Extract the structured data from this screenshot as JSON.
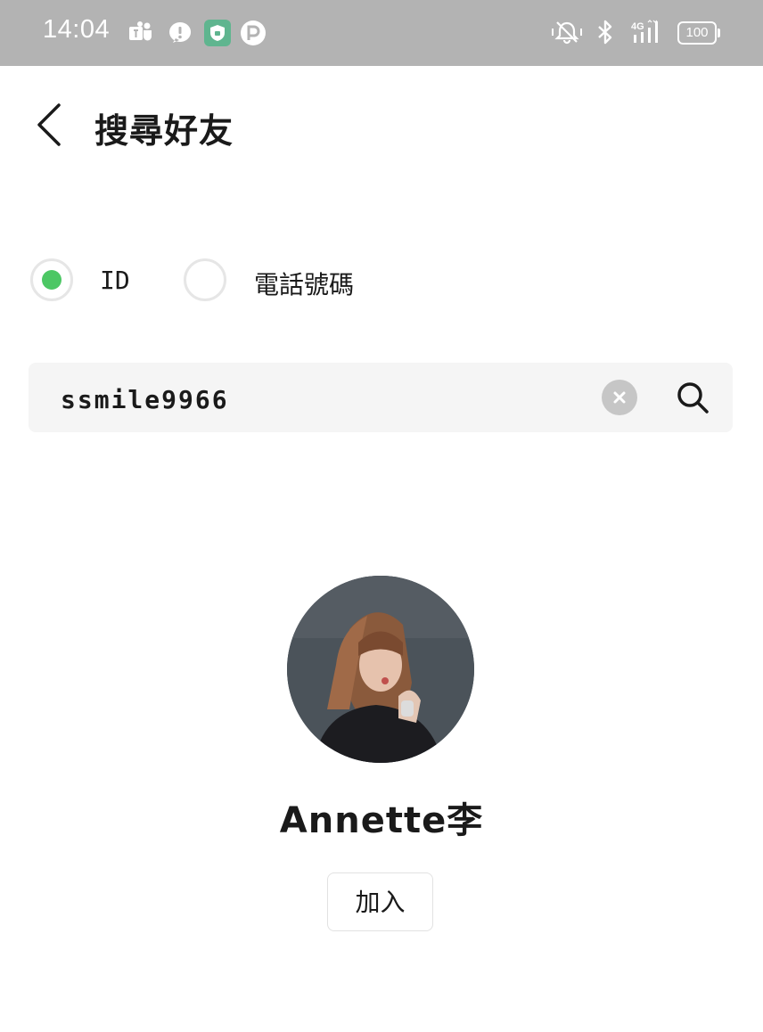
{
  "status_bar": {
    "time": "14:04",
    "battery": "100",
    "network": "4G",
    "left_icons": [
      "teams-icon",
      "chat-bubble-icon",
      "shield-app-icon",
      "p-app-icon"
    ],
    "right_icons": [
      "mute-icon",
      "bluetooth-icon",
      "signal-icon",
      "battery-icon"
    ]
  },
  "header": {
    "title": "搜尋好友",
    "back_icon": "chevron-left-icon"
  },
  "search_type": {
    "options": [
      {
        "label": "ID",
        "selected": true
      },
      {
        "label": "電話號碼",
        "selected": false
      }
    ],
    "selected_color": "#4cc764"
  },
  "search": {
    "value": "ssmile9966",
    "clear_icon": "clear-icon",
    "search_icon": "search-icon"
  },
  "result": {
    "name": "Annette李",
    "add_label": "加入"
  },
  "colors": {
    "status_bar": "#b3b3b3",
    "accent": "#4cc764",
    "search_bg": "#f5f5f5"
  }
}
